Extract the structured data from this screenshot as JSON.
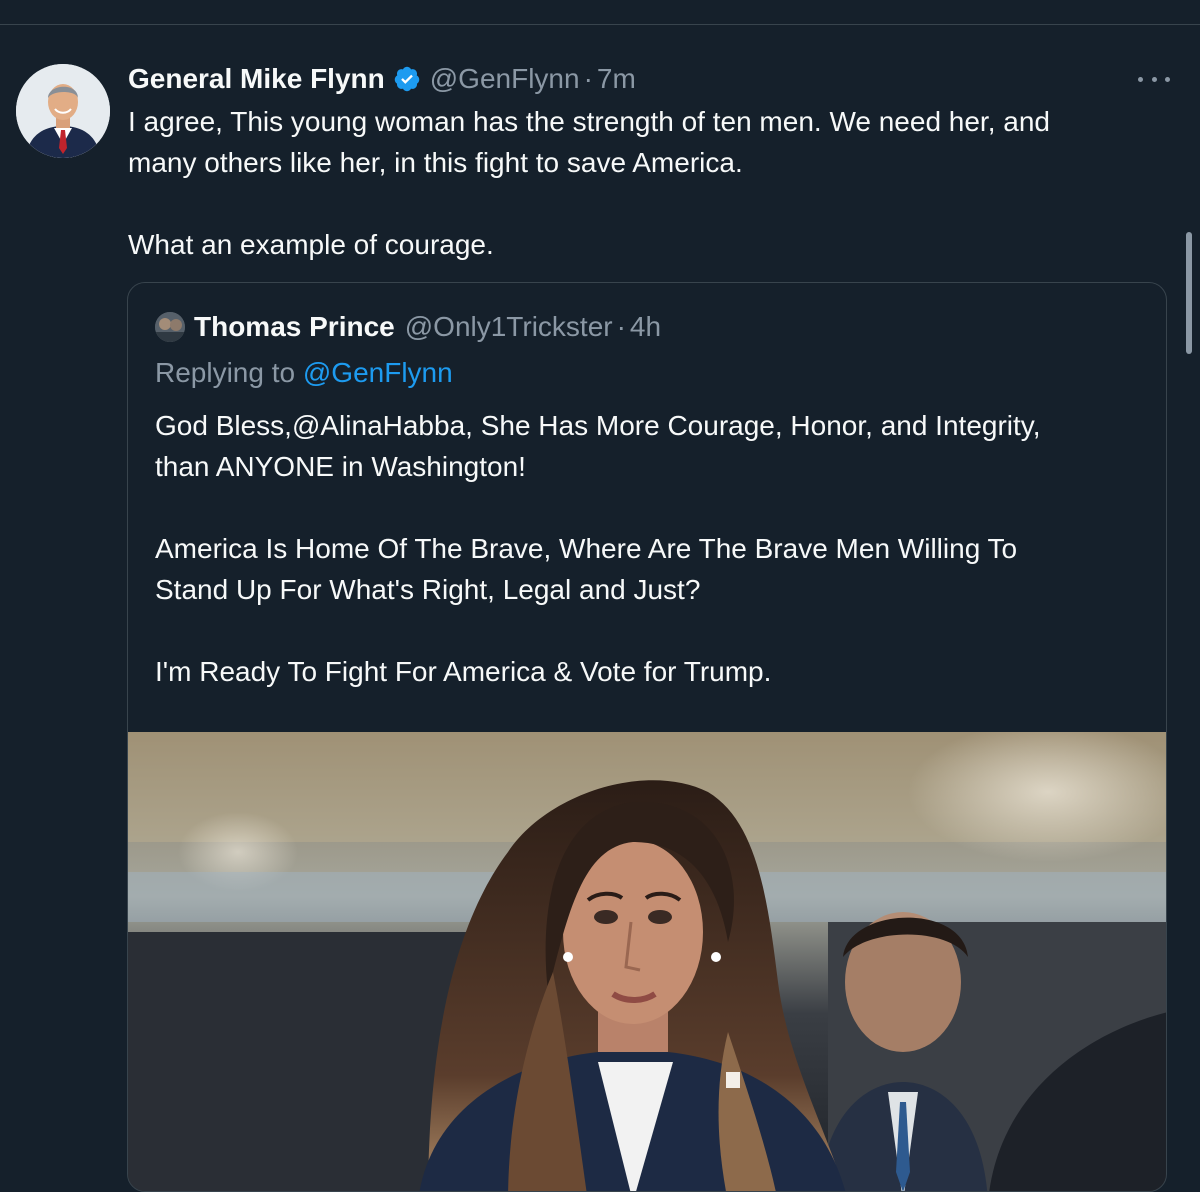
{
  "tweet": {
    "author": {
      "name": "General Mike Flynn",
      "handle": "@GenFlynn",
      "verified": true
    },
    "separator": "·",
    "time": "7m",
    "text": "I agree, This young woman has the strength of ten men. We need her, and\nmany others like her, in this fight to save America.\n\nWhat an example of courage."
  },
  "quote": {
    "author": {
      "name": "Thomas Prince",
      "handle": "@Only1Trickster"
    },
    "separator": "·",
    "time": "4h",
    "replying_prefix": "Replying to ",
    "replying_to": "@GenFlynn",
    "text": "God Bless,@AlinaHabba, She Has More Courage, Honor, and Integrity,\nthan ANYONE in Washington!\n\nAmerica Is Home Of The Brave, Where Are The Brave Men Willing To\nStand Up For What's Right, Legal and Just?\n\nI'm Ready To Fight For America & Vote for Trump."
  },
  "icons": {
    "verified": "verified-badge-icon",
    "more": "more-horizontal-icon"
  },
  "colors": {
    "background": "#15202b",
    "text_primary": "#f7f9f9",
    "text_secondary": "#8b98a5",
    "accent": "#1d9bf0",
    "border": "#38444d"
  }
}
